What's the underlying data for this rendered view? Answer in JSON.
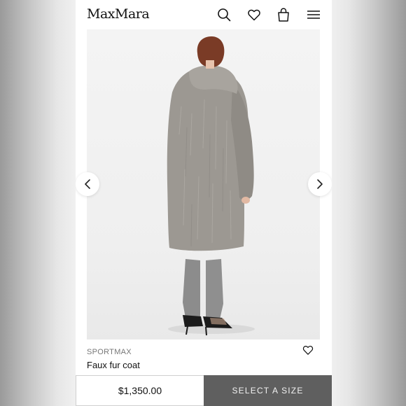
{
  "header": {
    "logo": "MaxMara",
    "icons": [
      "search-icon",
      "heart-icon",
      "bag-icon",
      "menu-icon"
    ]
  },
  "product": {
    "brand": "SPORTMAX",
    "name": "Faux fur coat",
    "price": "$1,350.00",
    "image_alt": "Model wearing grey faux fur coat, rear view"
  },
  "actions": {
    "select_size_label": "SELECT A SIZE"
  },
  "colors": {
    "coat": "#9c9892",
    "cta_background": "#5f5f5f"
  }
}
